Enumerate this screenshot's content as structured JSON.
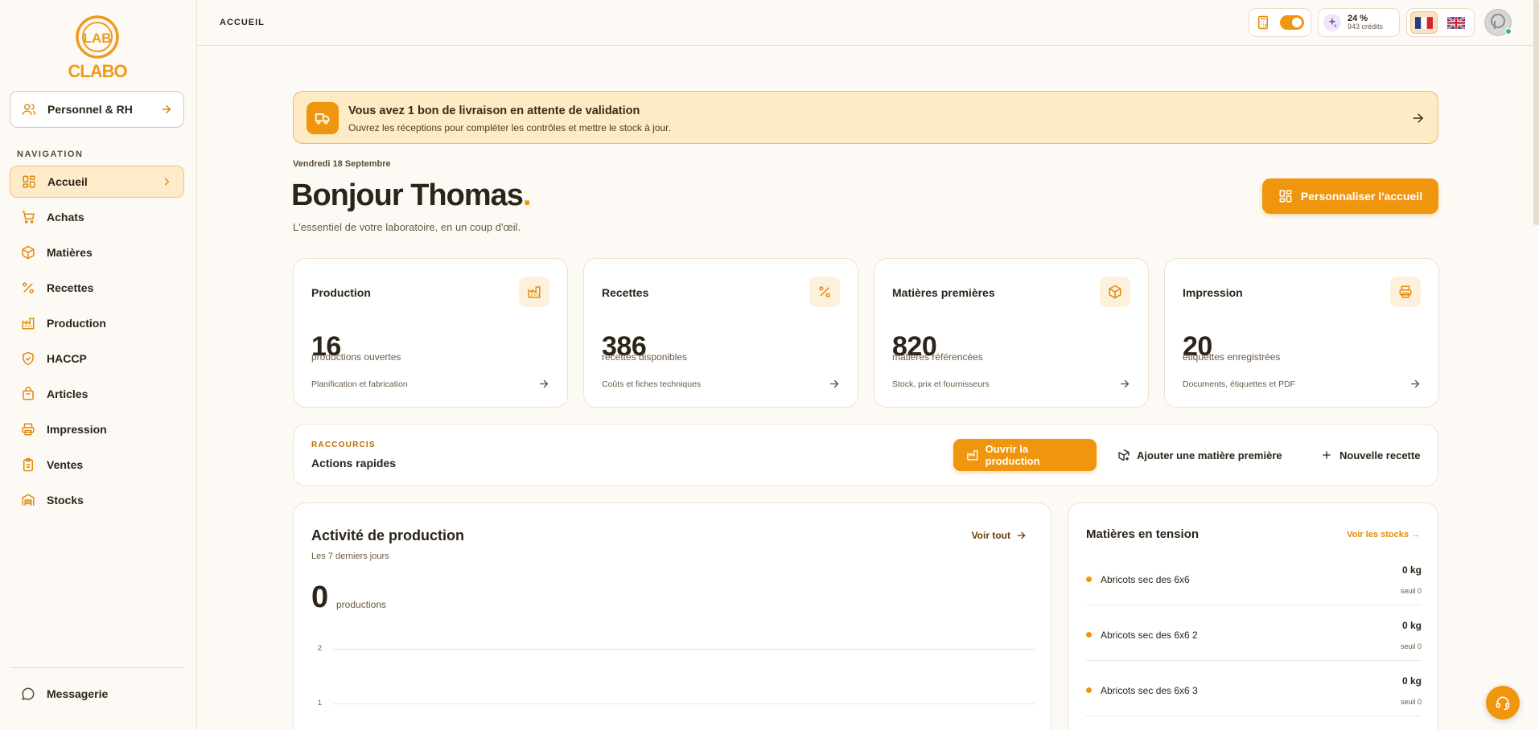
{
  "app": {
    "logo_top": "LAB",
    "logo_bottom": "CLABO"
  },
  "sidebar": {
    "module_label": "Personnel & RH",
    "nav_heading": "NAVIGATION",
    "items": [
      {
        "label": "Accueil",
        "icon": "grid-icon",
        "active": true
      },
      {
        "label": "Achats",
        "icon": "cart-icon"
      },
      {
        "label": "Matières",
        "icon": "box-icon"
      },
      {
        "label": "Recettes",
        "icon": "percent-icon"
      },
      {
        "label": "Production",
        "icon": "factory-icon"
      },
      {
        "label": "HACCP",
        "icon": "shield-check-icon"
      },
      {
        "label": "Articles",
        "icon": "bag-icon"
      },
      {
        "label": "Impression",
        "icon": "printer-icon"
      },
      {
        "label": "Ventes",
        "icon": "clipboard-icon"
      },
      {
        "label": "Stocks",
        "icon": "warehouse-icon"
      }
    ],
    "messaging_label": "Messagerie"
  },
  "topbar": {
    "breadcrumb": "ACCUEIL",
    "credits_percent": "24 %",
    "credits_amount": "943 crédits",
    "languages": [
      "fr",
      "en"
    ],
    "selected_language": "fr"
  },
  "banner": {
    "title": "Vous avez 1 bon de livraison en attente de validation",
    "subtitle": "Ouvrez les réceptions pour compléter les contrôles et mettre le stock à jour."
  },
  "greeting": {
    "date": "Vendredi 18 Septembre",
    "hello": "Bonjour Thomas",
    "dot": ".",
    "tagline": "L'essentiel de votre laboratoire, en un coup d'œil.",
    "customize_label": "Personnaliser l'accueil"
  },
  "stats": [
    {
      "title": "Production",
      "value": "16",
      "unit": "productions ouvertes",
      "footer": "Planification et fabrication",
      "icon": "factory-icon"
    },
    {
      "title": "Recettes",
      "value": "386",
      "unit": "recettes disponibles",
      "footer": "Coûts et fiches techniques",
      "icon": "percent-icon"
    },
    {
      "title": "Matières premières",
      "value": "820",
      "unit": "matières référencées",
      "footer": "Stock, prix et fournisseurs",
      "icon": "box-icon"
    },
    {
      "title": "Impression",
      "value": "20",
      "unit": "étiquettes enregistrées",
      "footer": "Documents, étiquettes et PDF",
      "icon": "printer-icon"
    }
  ],
  "shortcuts": {
    "kicker": "RACCOURCIS",
    "title": "Actions rapides",
    "buttons": [
      "Ouvrir la production",
      "Ajouter une matière première",
      "Nouvelle recette"
    ]
  },
  "activity": {
    "title": "Activité de production",
    "subtitle": "Les 7 derniers jours",
    "link": "Voir tout",
    "total": "0",
    "unit": "productions",
    "y_ticks": [
      "2",
      "1"
    ]
  },
  "tension": {
    "title": "Matières en tension",
    "link": "Voir les stocks →",
    "items": [
      {
        "name": "Abricots sec des 6x6",
        "qty": "0 kg",
        "seuil": "seuil 0"
      },
      {
        "name": "Abricots sec des 6x6 2",
        "qty": "0 kg",
        "seuil": "seuil 0"
      },
      {
        "name": "Abricots sec des 6x6 3",
        "qty": "0 kg",
        "seuil": "seuil 0"
      }
    ]
  },
  "colors": {
    "accent": "#f0950e",
    "background": "#fdfaf6",
    "banner_bg": "#fdebc6",
    "online": "#27c06b"
  }
}
